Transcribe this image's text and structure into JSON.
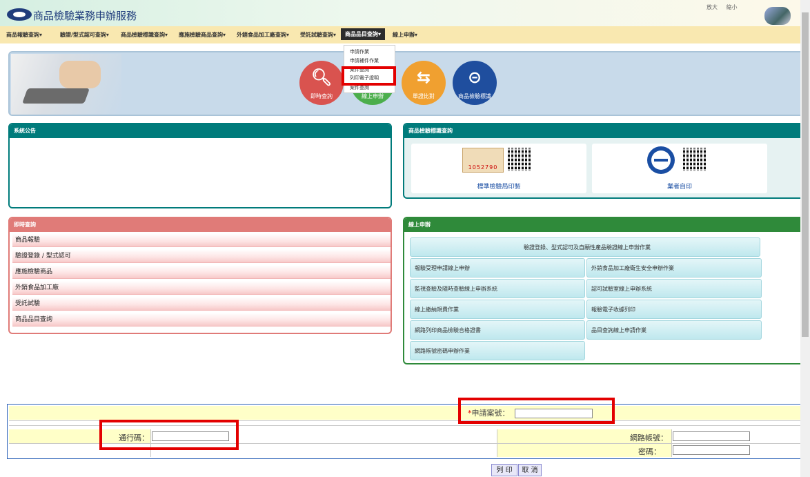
{
  "header": {
    "title": "商品檢驗業務申辦服務",
    "top_links": [
      "放大",
      "縮小"
    ]
  },
  "nav": {
    "items": [
      {
        "label": "商品報驗查詢▾",
        "active": false
      },
      {
        "label": "驗證/型式認可查詢▾",
        "active": false
      },
      {
        "label": "商品檢驗標識查詢▾",
        "active": false
      },
      {
        "label": "應施檢驗商品查詢▾",
        "active": false
      },
      {
        "label": "外銷食品加工廠查詢▾",
        "active": false
      },
      {
        "label": "受託試驗查詢▾",
        "active": false
      },
      {
        "label": "商品品目查詢▾",
        "active": true
      },
      {
        "label": "線上申辦▾",
        "active": false
      }
    ]
  },
  "dropdown": {
    "items": [
      "申請作業",
      "申請補件作業",
      "案件查詢",
      "列印電子證明",
      "案件查詢"
    ]
  },
  "banner": {
    "buttons": [
      {
        "label": "即時查詢",
        "icon": "search-icon",
        "color": "#d9534f"
      },
      {
        "label": "線上申辦",
        "icon": "edit-icon",
        "color": "#4cae4c"
      },
      {
        "label": "單證比對",
        "icon": "shuffle-icon",
        "color": "#f0a030"
      },
      {
        "label": "商品檢驗標識",
        "icon": "inspection-mark-icon",
        "color": "#1f4e9e"
      }
    ]
  },
  "announcements": {
    "title": "系統公告"
  },
  "inspection_mark": {
    "title": "商品檢驗標識查詢",
    "cards": [
      {
        "caption": "標準檢驗局印製",
        "number": "1052790"
      },
      {
        "caption": "業者自印"
      }
    ]
  },
  "instant_query": {
    "title": "即時查詢",
    "items": [
      "商品報驗",
      "驗證登錄 / 型式認可",
      "應施檢驗商品",
      "外銷食品加工廠",
      "受託試驗",
      "商品品目查詢"
    ]
  },
  "online_apply": {
    "title": "線上申辦",
    "header_button": "驗證登錄、型式認可及自願性產品驗證線上申辦作業",
    "buttons": [
      "報驗受理申請線上申辦",
      "外銷食品加工廠衛生安全申辦作業",
      "監視查驗及隨時查驗線上申辦系統",
      "認可試驗室線上申辦系統",
      "線上繳納規費作業",
      "報驗電子收據列印",
      "網路列印商品檢驗合格證書",
      "品目查詢線上申請作業",
      "網路帳號密碼申辦作業"
    ]
  },
  "form": {
    "application_no_label": "*申請案號：",
    "passcode_label": "通行碼：",
    "account_label": "網路帳號：",
    "password_label": "密碼：",
    "application_no_value": "",
    "passcode_value": "",
    "account_value": "",
    "password_value": ""
  },
  "actions": {
    "print_label": "列 印",
    "cancel_label": "取 消"
  },
  "colors": {
    "highlight": "#e30000",
    "nav_bg": "#f9e8b0",
    "teal": "#007b7b",
    "query_red": "#e07b78",
    "online_green": "#2f8a3a"
  }
}
